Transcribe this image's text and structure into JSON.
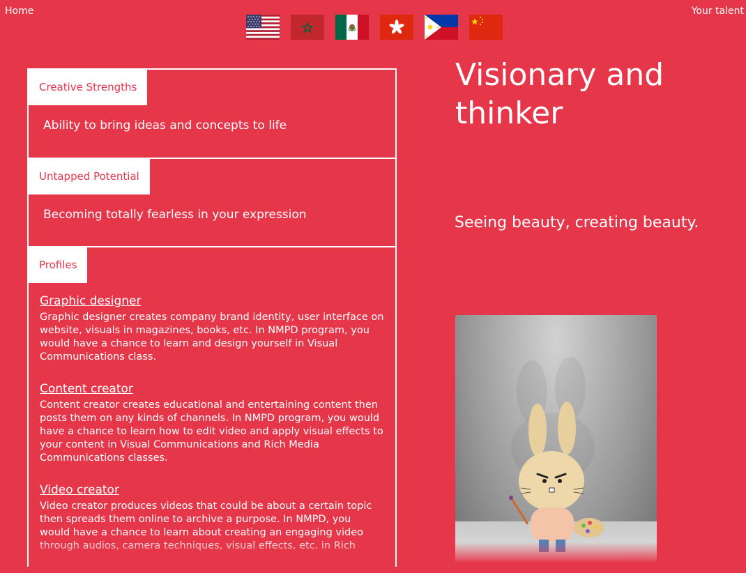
{
  "nav": {
    "home": "Home",
    "your_talent": "Your talent"
  },
  "flags": [
    {
      "country": "United States",
      "icon": "us-flag-icon"
    },
    {
      "country": "Morocco",
      "icon": "morocco-flag-icon"
    },
    {
      "country": "Mexico",
      "icon": "mexico-flag-icon"
    },
    {
      "country": "Hong Kong",
      "icon": "hong-kong-flag-icon"
    },
    {
      "country": "Philippines",
      "icon": "philippines-flag-icon"
    },
    {
      "country": "China",
      "icon": "china-flag-icon"
    }
  ],
  "sections": {
    "creative_strengths": {
      "tab": "Creative Strengths",
      "text": "Ability to bring ideas and concepts to life"
    },
    "untapped_potential": {
      "tab": "Untapped Potential",
      "text": "Becoming totally fearless in your expression"
    },
    "profiles": {
      "tab": "Profiles",
      "items": [
        {
          "title": "Graphic designer",
          "desc": "Graphic designer creates company brand identity, user interface on website, visuals in magazines, books, etc. In NMPD program, you would have a chance to learn and design yourself in Visual Communications class."
        },
        {
          "title": "Content creator",
          "desc": "Content creator creates educational and entertaining content then posts them on any kinds of channels. In NMPD program, you would have a chance to learn how to edit video and apply visual effects to your content in Visual Communications and Rich Media Communications classes."
        },
        {
          "title": "Video creator",
          "desc": "Video creator produces videos that could be about a certain topic then spreads them online to archive a purpose. In NMPD, you would have a chance to learn about creating an engaging video through audios, camera techniques, visual effects, etc. in Rich"
        }
      ]
    }
  },
  "headline": "Visionary and thinker",
  "tagline": "Seeing beauty, creating beauty.",
  "colors": {
    "background": "#e6364a",
    "text": "#ffffff"
  }
}
